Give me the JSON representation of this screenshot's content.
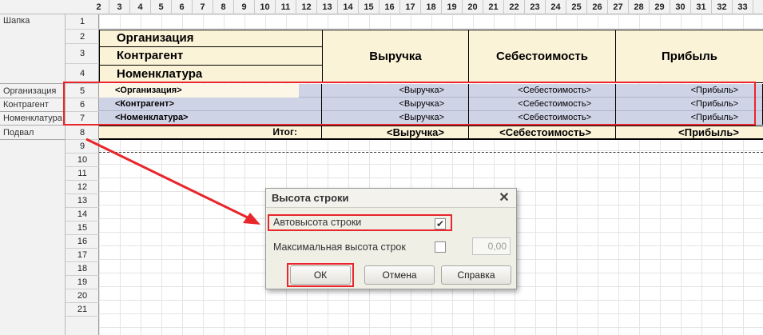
{
  "column_numbers": [
    "2",
    "3",
    "4",
    "5",
    "6",
    "7",
    "8",
    "9",
    "10",
    "11",
    "12",
    "13",
    "14",
    "15",
    "16",
    "17",
    "18",
    "19",
    "20",
    "21",
    "22",
    "23",
    "24",
    "25",
    "26",
    "27",
    "28",
    "29",
    "30",
    "31",
    "32",
    "33"
  ],
  "row_numbers": [
    "1",
    "2",
    "3",
    "4",
    "5",
    "6",
    "7",
    "8",
    "9",
    "10",
    "11",
    "12",
    "13",
    "14",
    "15",
    "16",
    "17",
    "18",
    "19",
    "20",
    "21"
  ],
  "groups": {
    "header": "Шапка",
    "organization": "Организация",
    "counterparty": "Контрагент",
    "nomenclature": "Номенклатура",
    "footer": "Подвал"
  },
  "header": {
    "dim_organization": "Организация",
    "dim_counterparty": "Контрагент",
    "dim_nomenclature": "Номенклатура",
    "revenue": "Выручка",
    "cost": "Себестоимость",
    "profit": "Прибыль"
  },
  "rows": [
    {
      "label": "<Организация>",
      "revenue": "<Выручка>",
      "cost": "<Себестоимость>",
      "profit": "<Прибыль>"
    },
    {
      "label": "<Контрагент>",
      "revenue": "<Выручка>",
      "cost": "<Себестоимость>",
      "profit": "<Прибыль>"
    },
    {
      "label": "<Номенклатура>",
      "revenue": "<Выручка>",
      "cost": "<Себестоимость>",
      "profit": "<Прибыль>"
    }
  ],
  "footer": {
    "total_label": "Итог:",
    "revenue": "<Выручка>",
    "cost": "<Себестоимость>",
    "profit": "<Прибыль>"
  },
  "dialog": {
    "title": "Высота строки",
    "auto_height_label": "Автовысота строки",
    "auto_height_checked": true,
    "max_height_label": "Максимальная высота строк",
    "max_height_checked": false,
    "max_height_value": "0,00",
    "ok": "ОК",
    "cancel": "Отмена",
    "help": "Справка"
  },
  "colors": {
    "highlight": "#e8262b",
    "header_fill": "#fbf3d7",
    "row_fill": "#cfd3e6"
  }
}
